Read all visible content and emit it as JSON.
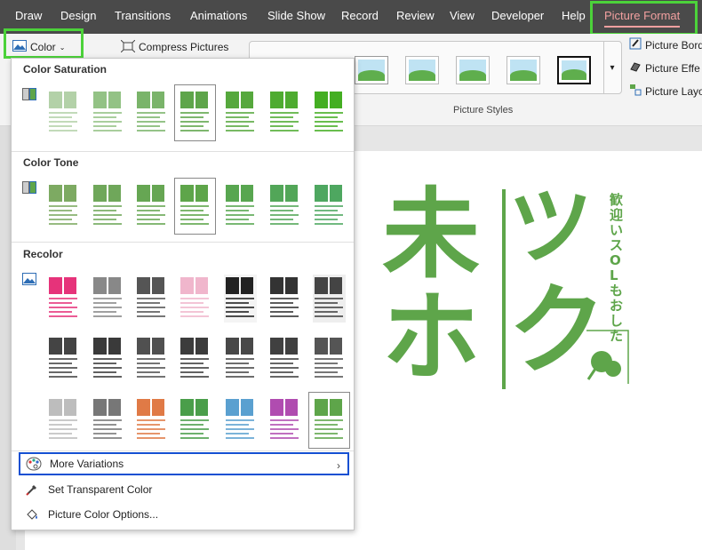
{
  "menubar": {
    "tabs": [
      "Draw",
      "Design",
      "Transitions",
      "Animations",
      "Slide Show",
      "Record",
      "Review",
      "View",
      "Developer",
      "Help"
    ],
    "active_tab": "Picture Format"
  },
  "ribbon": {
    "color_button": "Color",
    "compress_button": "Compress Pictures",
    "picture_styles_label": "Picture Styles",
    "picture_border": "Picture Bord",
    "picture_effects": "Picture Effe",
    "picture_layout": "Picture Layo"
  },
  "dropdown": {
    "color_saturation": "Color Saturation",
    "color_tone": "Color Tone",
    "recolor": "Recolor",
    "more_variations": "More Variations",
    "set_transparent_color": "Set Transparent Color",
    "picture_color_options": "Picture Color Options..."
  },
  "slide_art": {
    "left_chars": [
      "未",
      "ホ"
    ],
    "right_chars": [
      "ツ",
      "ク"
    ],
    "vertical_text": "歓迎いスOLもおした"
  },
  "colors": {
    "highlight_green": "#4cd23a",
    "highlight_blue": "#1550d2",
    "art_green": "#5ea54a",
    "menubar_bg": "#4a4a4a",
    "active_tab": "#f2a0a0"
  }
}
